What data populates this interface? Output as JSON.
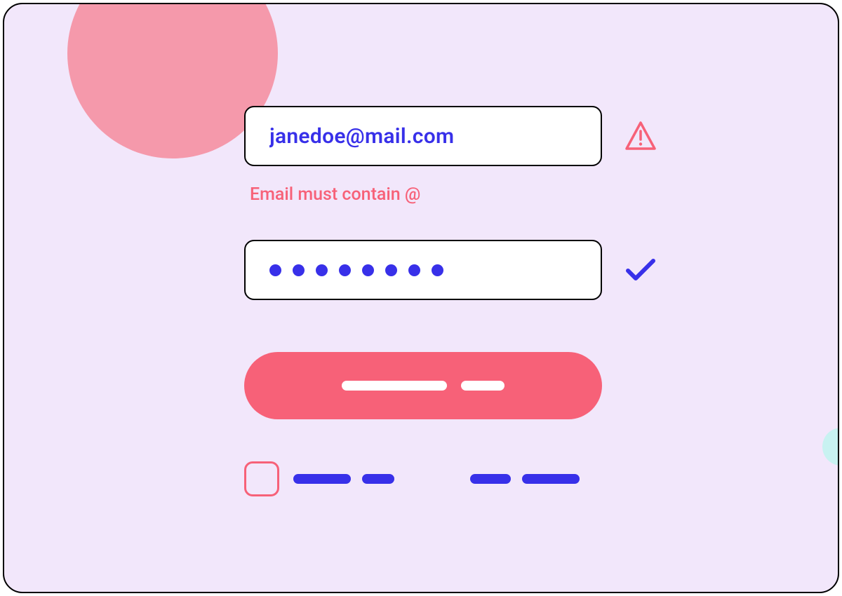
{
  "form": {
    "email": {
      "value": "janedoe@mail.com",
      "error": "Email must contain @",
      "status": "error"
    },
    "password": {
      "mask_count": 8,
      "status": "valid"
    },
    "checkbox": {
      "checked": false
    }
  },
  "colors": {
    "background": "#f2e7fb",
    "accent_pink": "#f76178",
    "accent_blue": "#3830e9",
    "decor_pink": "#f599ab",
    "decor_cyan": "#c8f2f1"
  },
  "icons": {
    "alert": "alert-triangle-icon",
    "check": "check-icon"
  }
}
